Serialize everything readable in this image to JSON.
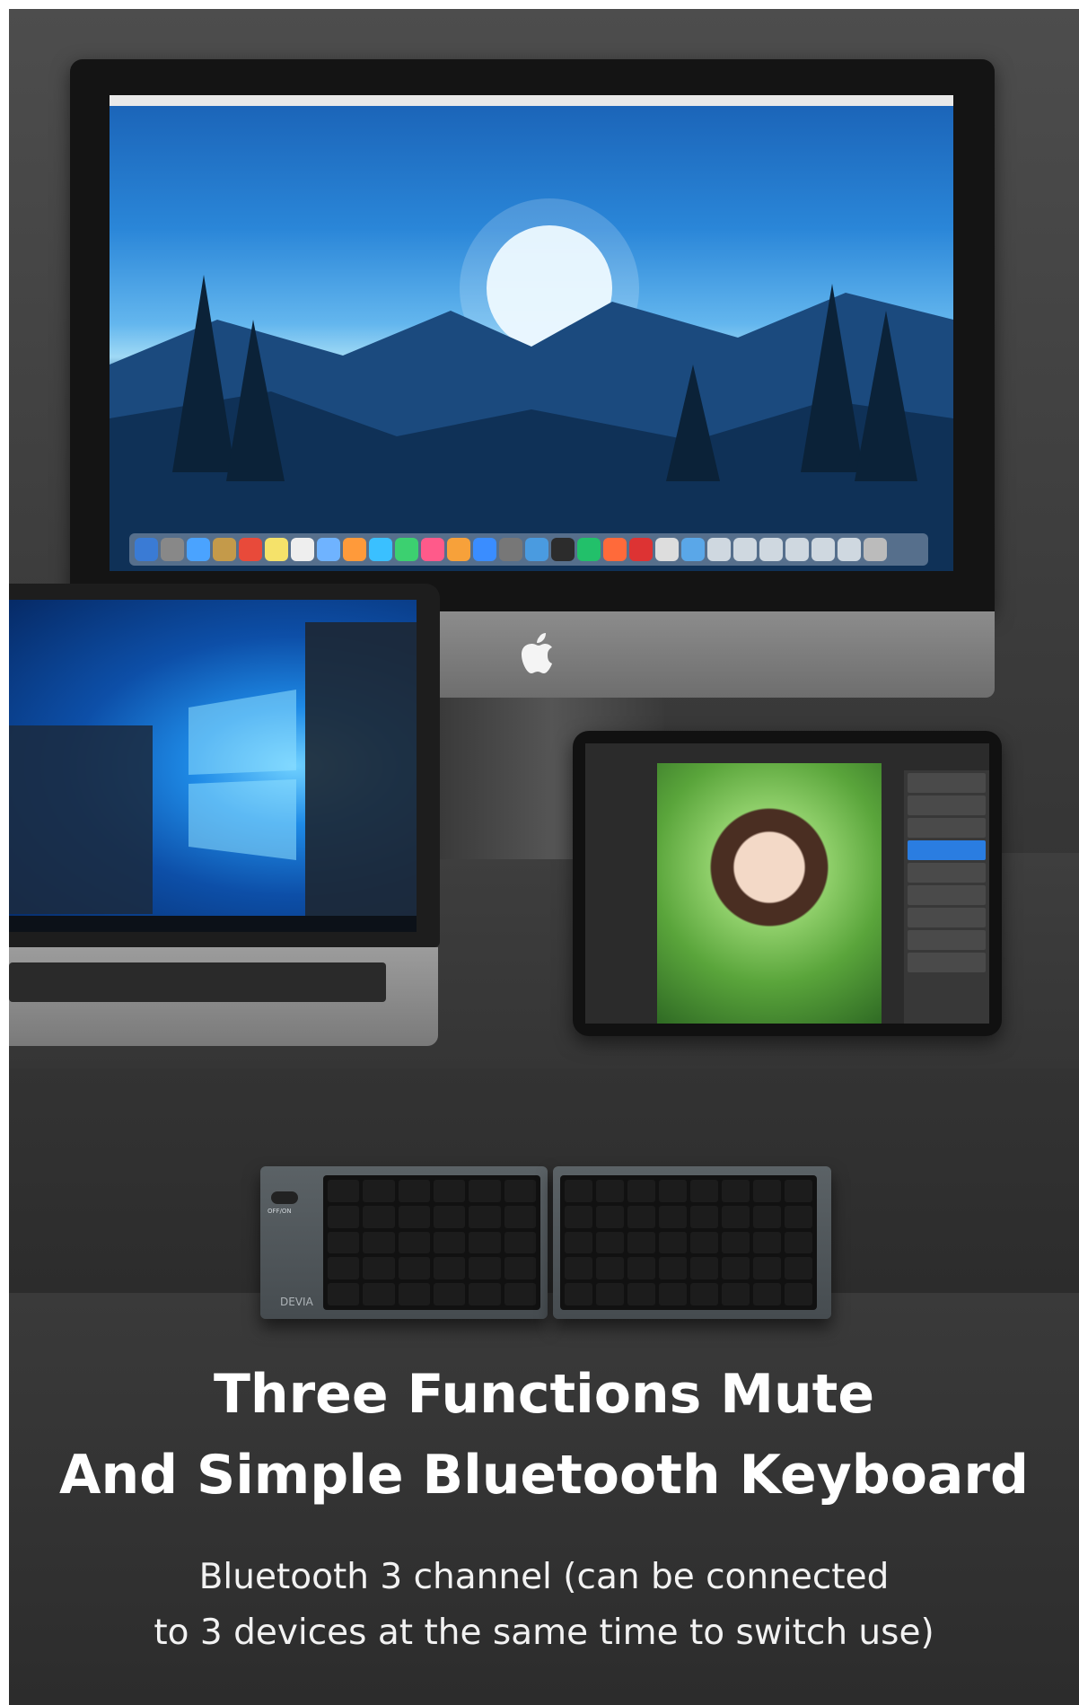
{
  "headline": {
    "line1": "Three Functions Mute",
    "line2": "And Simple Bluetooth Keyboard"
  },
  "subtext": {
    "line1": "Bluetooth 3 channel (can be connected",
    "line2": "to 3 devices at the same time to switch use)"
  },
  "keyboard": {
    "brand": "DEVIA",
    "switch_label": "OFF/ON"
  },
  "colors": {
    "background": "#3a3a3a",
    "text": "#ffffff"
  }
}
